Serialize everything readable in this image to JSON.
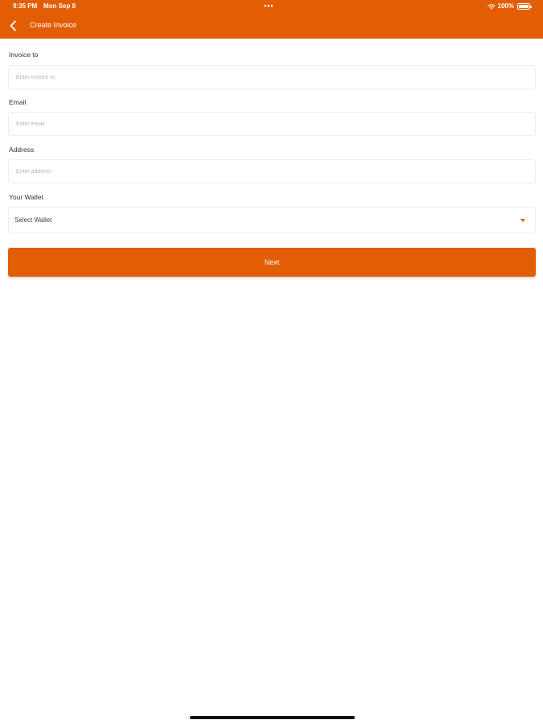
{
  "status_bar": {
    "time": "9:35 PM",
    "date": "Mon Sep 8",
    "dots": "•••",
    "battery": "100%",
    "icons": [
      "wifi-icon",
      "battery-icon"
    ]
  },
  "nav": {
    "title": "Create Invoice",
    "back_icon": "chevron-left-icon"
  },
  "form": {
    "invoice_to": {
      "label": "Invoice to",
      "placeholder": "Enter invoice to",
      "value": ""
    },
    "email": {
      "label": "Email",
      "placeholder": "Enter email",
      "value": ""
    },
    "address": {
      "label": "Address",
      "placeholder": "Enter address",
      "value": ""
    },
    "wallet": {
      "label": "Your Wallet",
      "selected": "Select Wallet",
      "icon": "caret-down-icon"
    },
    "next_label": "Next"
  },
  "colors": {
    "accent": "#e35d05",
    "background": "#ffffff"
  }
}
